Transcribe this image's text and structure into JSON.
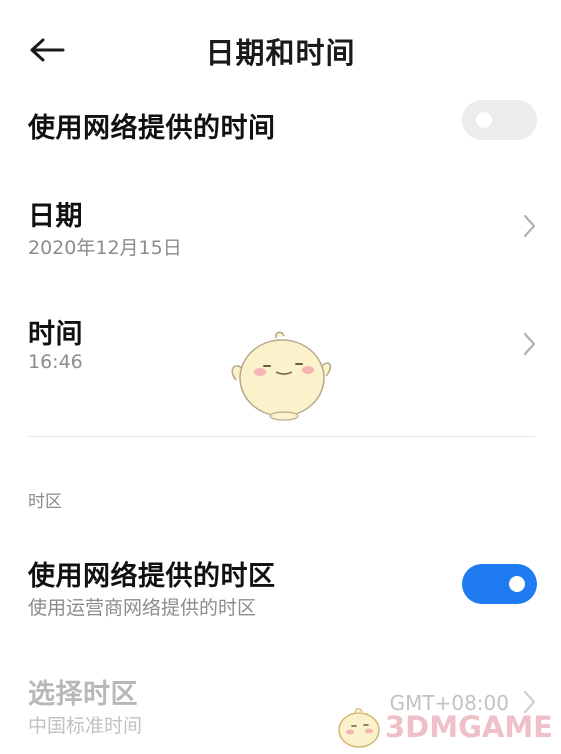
{
  "header": {
    "back_icon": "back-arrow-icon",
    "title": "日期和时间"
  },
  "network_time": {
    "label": "使用网络提供的时间",
    "enabled": false
  },
  "date": {
    "label": "日期",
    "value": "2020年12月15日"
  },
  "time": {
    "label": "时间",
    "value": "16:46"
  },
  "timezone_section": {
    "header": "时区"
  },
  "network_timezone": {
    "label": "使用网络提供的时区",
    "sub": "使用运营商网络提供的时区",
    "enabled": true
  },
  "select_timezone": {
    "label": "选择时区",
    "sub": "中国标准时间",
    "value": "GMT+08:00",
    "disabled": true
  },
  "watermark": {
    "text": "3DMGAME"
  },
  "colors": {
    "accent": "#1f7cf0",
    "toggle_off": "#ececec",
    "subtext": "#8c8c8c",
    "disabled_text": "#b8b8b8"
  }
}
